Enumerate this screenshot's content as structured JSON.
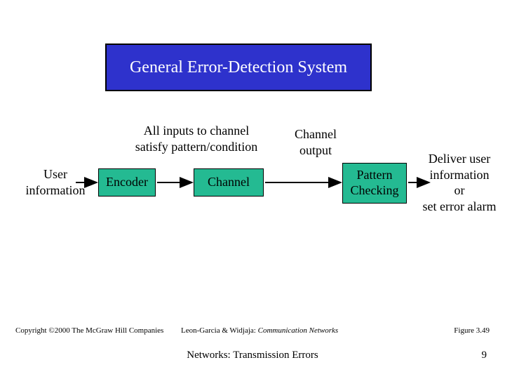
{
  "title": "General Error-Detection System",
  "labels": {
    "input": "User\ninformation",
    "annotation1": "All inputs to channel\nsatisfy pattern/condition",
    "annotation2": "Channel\noutput",
    "output": "Deliver user\ninformation\nor\nset error alarm"
  },
  "blocks": {
    "encoder": "Encoder",
    "channel": "Channel",
    "checker": "Pattern\nChecking"
  },
  "footer": {
    "copyright": "Copyright ©2000 The McGraw Hill Companies",
    "authors": "Leon-Garcia & Widjaja:",
    "book": "Communication Networks",
    "figure": "Figure 3.49",
    "topic": "Networks: Transmission Errors",
    "slide": "9"
  }
}
